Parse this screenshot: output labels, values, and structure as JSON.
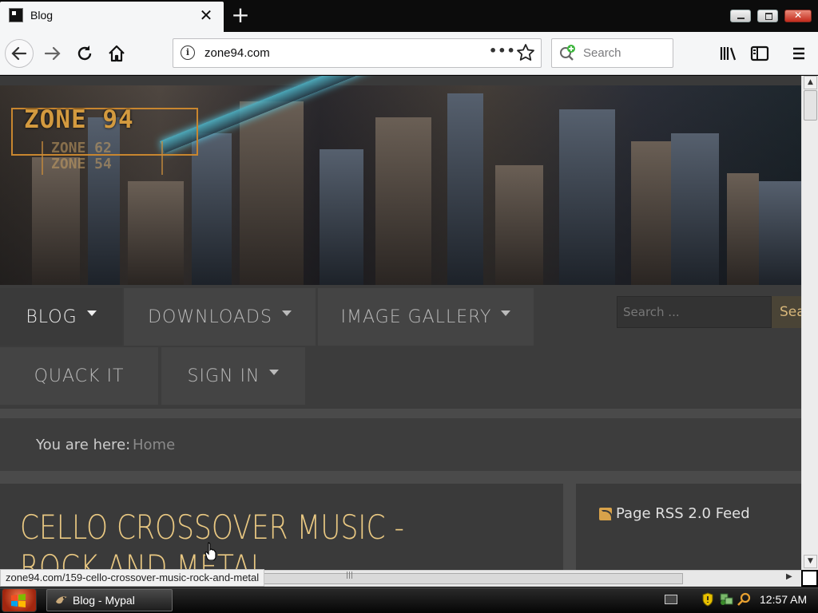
{
  "browser": {
    "tab_title": "Blog",
    "tab_close_glyph": "✕",
    "new_tab_glyph": "+",
    "url": "zone94.com",
    "page_actions_glyph": "•••",
    "search_placeholder": "Search",
    "status_url": "zone94.com/159-cello-crossover-music-rock-and-metal"
  },
  "site": {
    "logo_main": "ZONE 94",
    "logo_sub1": "ZONE 62",
    "logo_sub2": "ZONE 54",
    "nav": {
      "blog": "BLOG",
      "downloads": "DOWNLOADS",
      "image_gallery": "IMAGE GALLERY",
      "quack_it": "QUACK IT",
      "sign_in": "SIGN IN"
    },
    "search_placeholder": "Search ...",
    "search_button": "Search",
    "breadcrumb_label": "You are here:",
    "breadcrumb_home": "Home",
    "article_title": "CELLO CROSSOVER MUSIC - ROCK AND METAL",
    "sidebar_rss": "Page RSS 2.0 Feed"
  },
  "taskbar": {
    "task_label": "Blog - Mypal",
    "clock": "12:57 AM"
  },
  "colors": {
    "accent_gold": "#e9c882",
    "nav_bg": "#444444",
    "page_bg": "#3a3a3a"
  }
}
